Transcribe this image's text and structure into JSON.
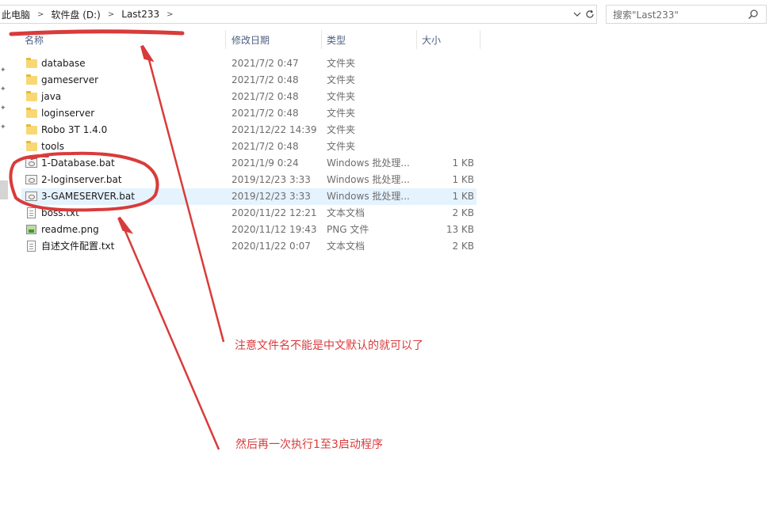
{
  "address": {
    "breadcrumb": [
      "此电脑",
      "软件盘 (D:)",
      "Last233"
    ]
  },
  "search": {
    "placeholder": "搜索\"Last233\""
  },
  "columns": {
    "name": "名称",
    "date": "修改日期",
    "type": "类型",
    "size": "大小"
  },
  "files": [
    {
      "name": "database",
      "date": "2021/7/2 0:47",
      "type": "文件夹",
      "size": "",
      "icon": "folder-icon"
    },
    {
      "name": "gameserver",
      "date": "2021/7/2 0:48",
      "type": "文件夹",
      "size": "",
      "icon": "folder-icon"
    },
    {
      "name": "java",
      "date": "2021/7/2 0:48",
      "type": "文件夹",
      "size": "",
      "icon": "folder-icon"
    },
    {
      "name": "loginserver",
      "date": "2021/7/2 0:48",
      "type": "文件夹",
      "size": "",
      "icon": "folder-icon"
    },
    {
      "name": "Robo 3T 1.4.0",
      "date": "2021/12/22 14:39",
      "type": "文件夹",
      "size": "",
      "icon": "folder-icon"
    },
    {
      "name": "tools",
      "date": "2021/7/2 0:48",
      "type": "文件夹",
      "size": "",
      "icon": "folder-icon"
    },
    {
      "name": "1-Database.bat",
      "date": "2021/1/9 0:24",
      "type": "Windows 批处理...",
      "size": "1 KB",
      "icon": "batch-file-icon"
    },
    {
      "name": "2-loginserver.bat",
      "date": "2019/12/23 3:33",
      "type": "Windows 批处理...",
      "size": "1 KB",
      "icon": "batch-file-icon"
    },
    {
      "name": "3-GAMESERVER.bat",
      "date": "2019/12/23 3:33",
      "type": "Windows 批处理...",
      "size": "1 KB",
      "icon": "batch-file-icon",
      "selected": true
    },
    {
      "name": "boss.txt",
      "date": "2020/11/22 12:21",
      "type": "文本文档",
      "size": "2 KB",
      "icon": "text-file-icon"
    },
    {
      "name": "readme.png",
      "date": "2020/11/12 19:43",
      "type": "PNG 文件",
      "size": "13 KB",
      "icon": "image-file-icon"
    },
    {
      "name": "自述文件配置.txt",
      "date": "2020/11/22 0:07",
      "type": "文本文档",
      "size": "2 KB",
      "icon": "text-file-icon"
    }
  ],
  "annotations": {
    "note1": "注意文件名不能是中文默认的就可以了",
    "note2": "然后再一次执行1至3启动程序",
    "color": "#d93b3b"
  }
}
